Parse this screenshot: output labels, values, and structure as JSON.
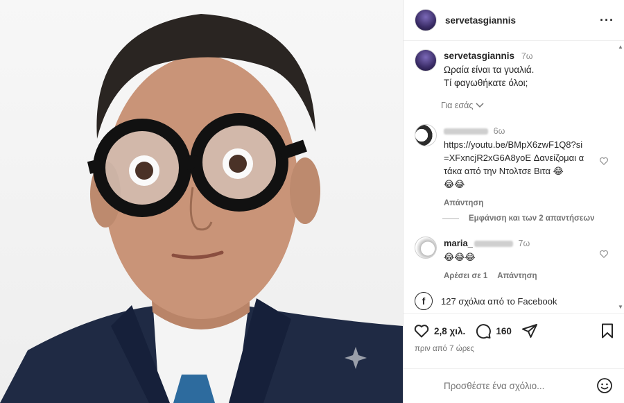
{
  "post": {
    "username": "servetasgiannis",
    "more_label": "···"
  },
  "caption": {
    "username": "servetasgiannis",
    "ago": "7ω",
    "line1": "Ωραία είναι τα γυαλιά.",
    "line2": "Τί φαγωθήκατε όλοι;",
    "for_you": "Για εσάς"
  },
  "comments": [
    {
      "ago": "6ω",
      "text": "https://youtu.be/BMpX6zwF1Q8?si=XFxncjR2xG6A8yoE Δανείζομαι ατάκα από την Ντολτσε Βιτα 😂",
      "emojis": "😂😂",
      "reply": "Απάντηση"
    },
    {
      "name": "maria_",
      "ago": "7ω",
      "emojis": "😂😂😂",
      "likes": "Αρέσει σε 1",
      "reply": "Απάντηση"
    }
  ],
  "show_replies": "Εμφάνιση και των 2 απαντήσεων",
  "facebook_comments": "127 σχόλια από το Facebook",
  "actions": {
    "likes": "2,8 χιλ.",
    "comments": "160",
    "timestamp": "πριν από 7 ώρες"
  },
  "add_comment": {
    "placeholder": "Προσθέστε ένα σχόλιο..."
  },
  "colors": {
    "suit": "#1f2a44",
    "tie": "#2d6b9e",
    "glasses": "#111111",
    "skin": "#c99478"
  }
}
